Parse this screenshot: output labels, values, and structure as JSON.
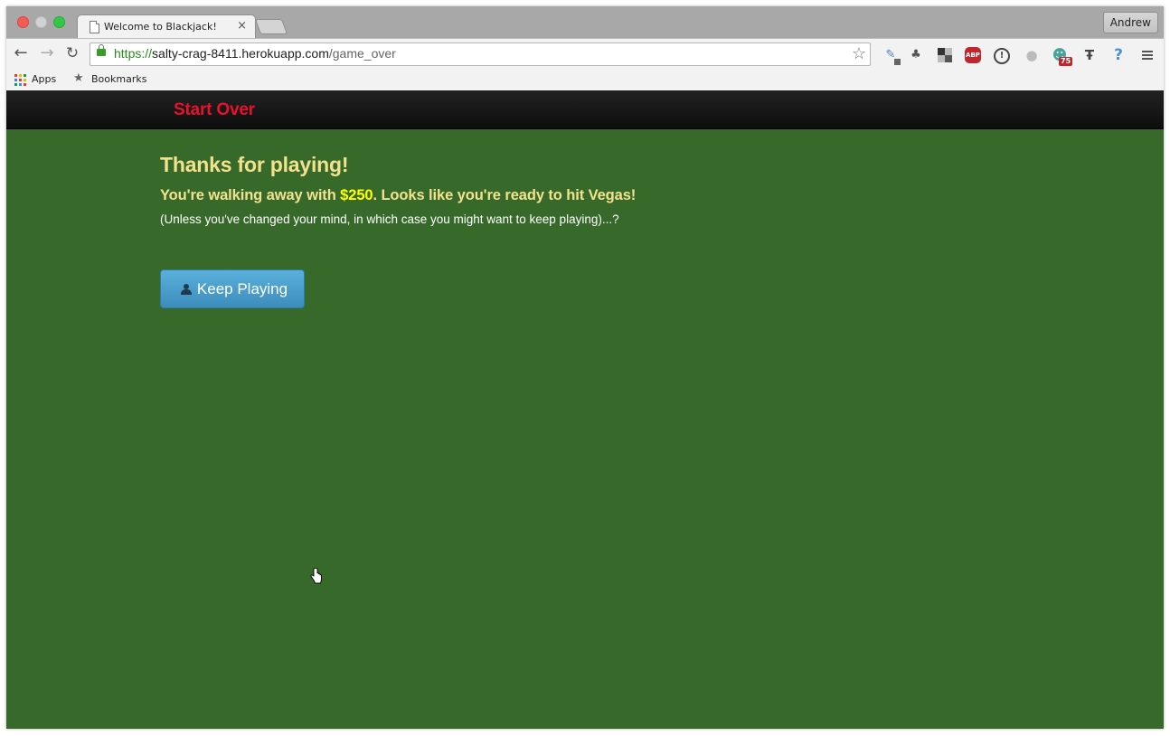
{
  "browser": {
    "tab_title": "Welcome to Blackjack!",
    "tab_close_glyph": "×",
    "profile_name": "Andrew",
    "url": {
      "scheme": "https://",
      "host": "salty-crag-8411.herokuapp.com",
      "path": "/game_over"
    },
    "extension_badge_count": "75",
    "bookmarks": {
      "apps_label": "Apps",
      "bookmarks_label": "Bookmarks"
    }
  },
  "page": {
    "nav": {
      "brand_label": "Start Over"
    },
    "heading": "Thanks for playing!",
    "message": {
      "before": "You're walking away with ",
      "amount": "$250",
      "after": ". Looks like you're ready to hit Vegas!"
    },
    "note": "(Unless you've changed your mind, in which case you might want to keep playing)...?",
    "keep_playing_label": "Keep Playing"
  },
  "colors": {
    "table_green": "#376a2a",
    "brand_red": "#e8112d",
    "heading_yellow": "#f2e28e",
    "money_yellow": "#ffff00",
    "button_blue": "#4a9ccb"
  }
}
